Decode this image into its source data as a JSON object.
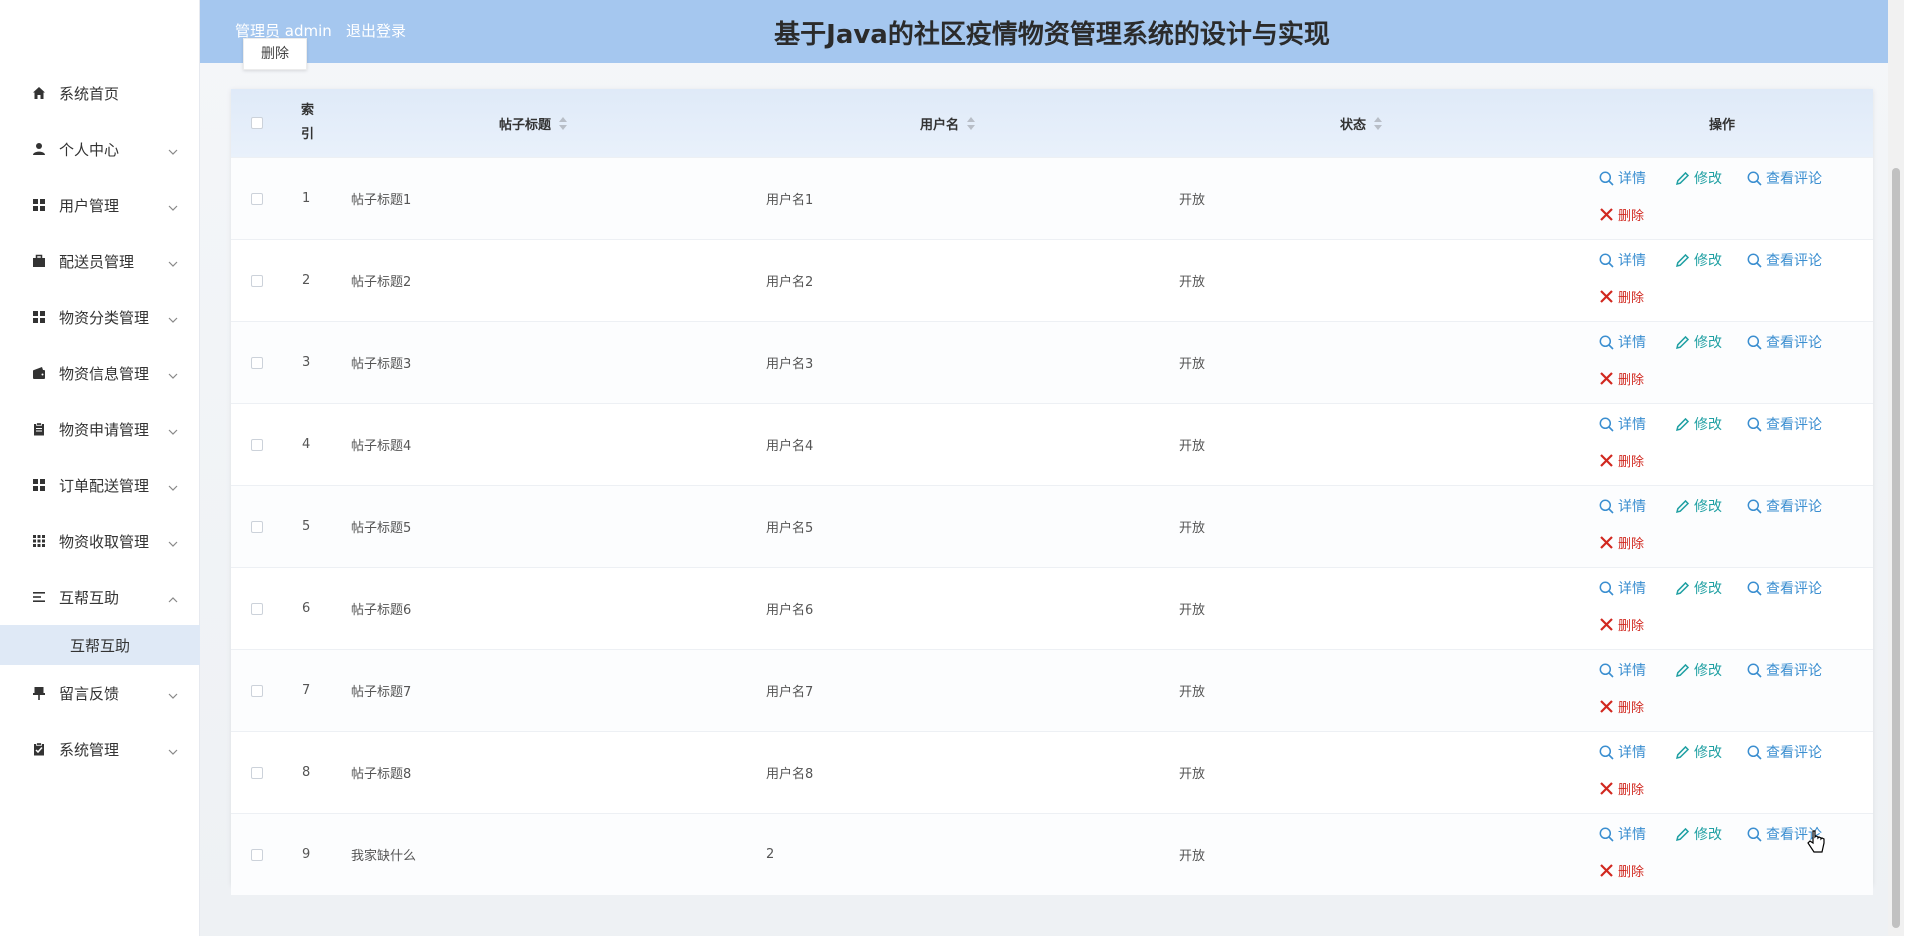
{
  "header": {
    "admin_label": "管理员 admin",
    "logout_label": "退出登录",
    "title": "基于Java的社区疫情物资管理系统的设计与实现",
    "bg_color": "#a5c7ef"
  },
  "toolbar": {
    "delete_label": "删除"
  },
  "sidebar": {
    "items": [
      {
        "label": "系统首页",
        "icon": "home-icon"
      },
      {
        "label": "个人中心",
        "icon": "user-icon"
      },
      {
        "label": "用户管理",
        "icon": "grid-icon"
      },
      {
        "label": "配送员管理",
        "icon": "briefcase-icon"
      },
      {
        "label": "物资分类管理",
        "icon": "grid-icon"
      },
      {
        "label": "物资信息管理",
        "icon": "wallet-icon"
      },
      {
        "label": "物资申请管理",
        "icon": "clipboard-icon"
      },
      {
        "label": "订单配送管理",
        "icon": "grid-icon"
      },
      {
        "label": "物资收取管理",
        "icon": "apps-icon"
      },
      {
        "label": "互帮互助",
        "icon": "list-icon",
        "expanded": true
      },
      {
        "label": "留言反馈",
        "icon": "pushpin-icon"
      },
      {
        "label": "系统管理",
        "icon": "clipboard-check-icon"
      }
    ],
    "active_sub": "互帮互助"
  },
  "table": {
    "headers": {
      "index": "索引",
      "title": "帖子标题",
      "username": "用户名",
      "status": "状态",
      "actions": "操作"
    },
    "actions": {
      "detail": "详情",
      "edit": "修改",
      "comments": "查看评论",
      "delete": "删除"
    },
    "rows": [
      {
        "index": "1",
        "title": "帖子标题1",
        "username": "用户名1",
        "status": "开放"
      },
      {
        "index": "2",
        "title": "帖子标题2",
        "username": "用户名2",
        "status": "开放"
      },
      {
        "index": "3",
        "title": "帖子标题3",
        "username": "用户名3",
        "status": "开放"
      },
      {
        "index": "4",
        "title": "帖子标题4",
        "username": "用户名4",
        "status": "开放"
      },
      {
        "index": "5",
        "title": "帖子标题5",
        "username": "用户名5",
        "status": "开放"
      },
      {
        "index": "6",
        "title": "帖子标题6",
        "username": "用户名6",
        "status": "开放"
      },
      {
        "index": "7",
        "title": "帖子标题7",
        "username": "用户名7",
        "status": "开放"
      },
      {
        "index": "8",
        "title": "帖子标题8",
        "username": "用户名8",
        "status": "开放"
      },
      {
        "index": "9",
        "title": "我家缺什么",
        "username": "2",
        "status": "开放"
      }
    ]
  },
  "colors": {
    "link": "#3a8ed0",
    "edit": "#20a0a3",
    "danger": "#d1281f",
    "active_sub_bg": "#dfe9f6"
  }
}
